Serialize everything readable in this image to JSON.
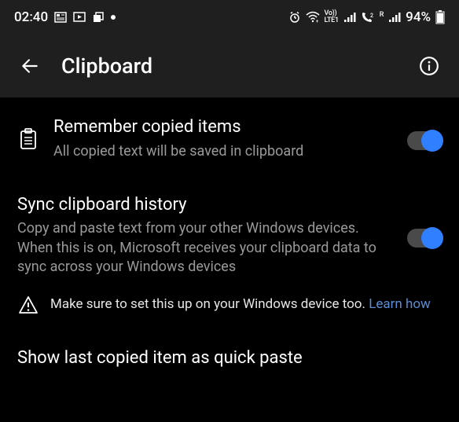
{
  "statusbar": {
    "time": "02:40",
    "battery_text": "94%",
    "lte_text": "Vo))\nLTE1",
    "r_text": "R"
  },
  "appbar": {
    "title": "Clipboard"
  },
  "settings": {
    "remember": {
      "title": "Remember copied items",
      "subtitle": "All copied text will be saved in clipboard",
      "on": true
    },
    "sync": {
      "title": "Sync clipboard history",
      "subtitle": "Copy and paste text from your other Windows devices. When this is on, Microsoft receives your clipboard data to sync across your Windows devices",
      "on": true
    },
    "warning": {
      "text": "Make sure to set this up on your Windows device too. ",
      "link": "Learn how"
    },
    "quickpaste": {
      "title": "Show last copied item as quick paste"
    }
  }
}
